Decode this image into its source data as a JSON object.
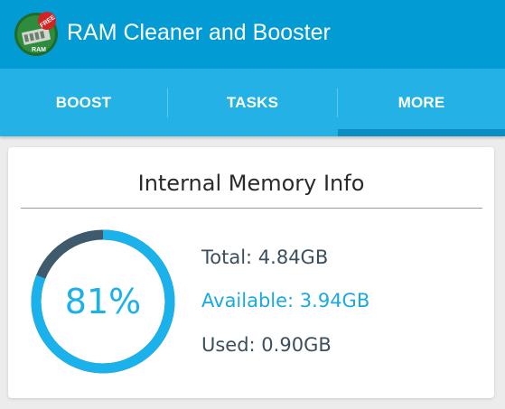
{
  "app": {
    "title": "RAM Cleaner and Booster",
    "icon_name": "ram-chip-icon",
    "icon_badge": "FREE",
    "icon_chip_text": "RAM"
  },
  "tabs": [
    {
      "label": "BOOST",
      "selected": false
    },
    {
      "label": "TASKS",
      "selected": false
    },
    {
      "label": "MORE",
      "selected": true
    }
  ],
  "memory": {
    "title": "Internal Memory Info",
    "percent_label": "81%",
    "percent_used": 81,
    "total": "Total: 4.84GB",
    "available": "Available: 3.94GB",
    "used": "Used: 0.90GB"
  },
  "colors": {
    "titlebar": "#039bd3",
    "tabbar": "#24b2e6",
    "tab_indicator": "#0a8ec4",
    "gauge_fill": "#1bb1ea",
    "gauge_track": "#3e5a6c",
    "available_text": "#1aa9e2"
  }
}
